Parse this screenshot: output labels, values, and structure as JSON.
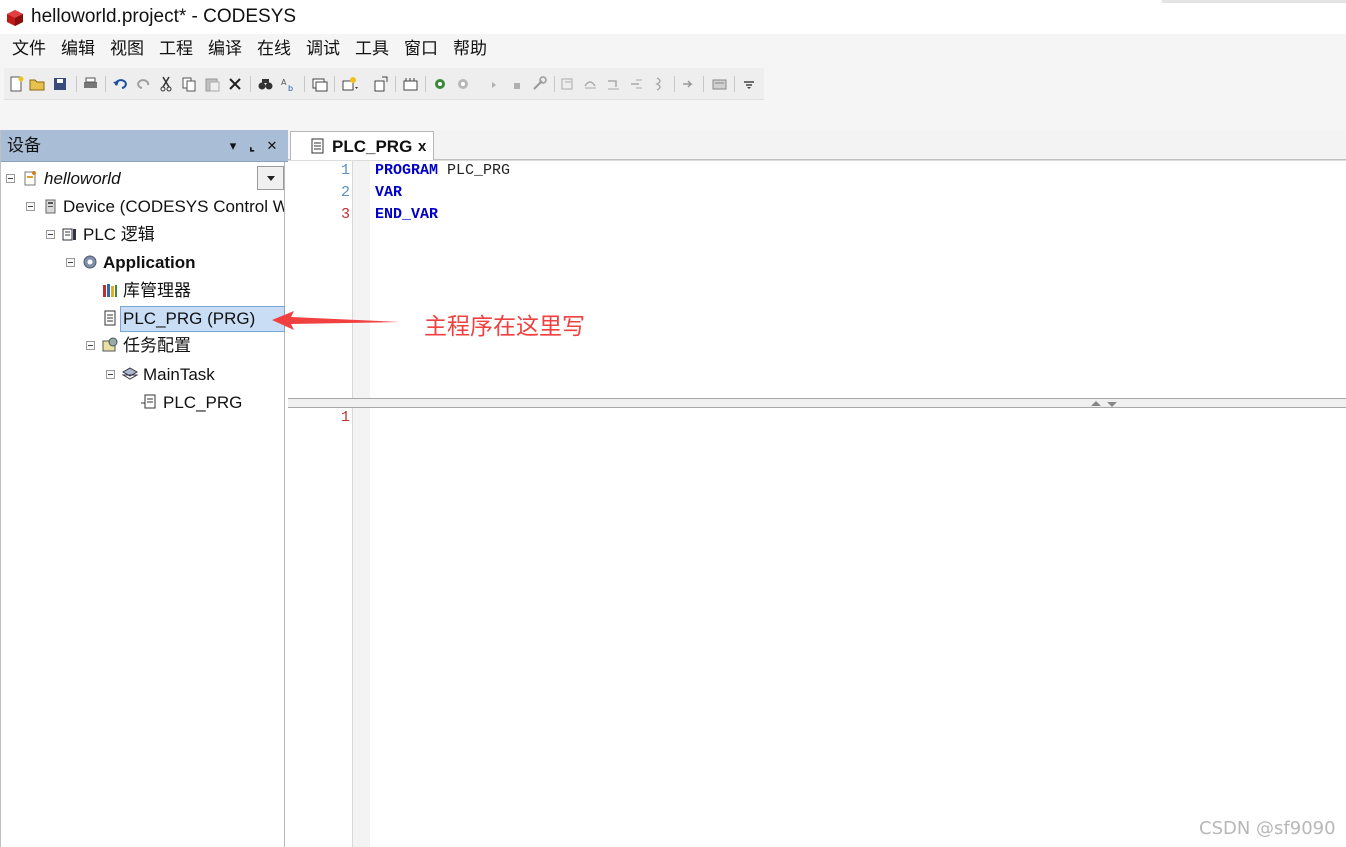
{
  "window": {
    "title": "helloworld.project* - CODESYS",
    "icon": "codesys-cube-icon"
  },
  "menu": {
    "items": [
      {
        "label": "文件"
      },
      {
        "label": "编辑"
      },
      {
        "label": "视图"
      },
      {
        "label": "工程"
      },
      {
        "label": "编译"
      },
      {
        "label": "在线"
      },
      {
        "label": "调试"
      },
      {
        "label": "工具"
      },
      {
        "label": "窗口"
      },
      {
        "label": "帮助"
      }
    ]
  },
  "toolbar": {
    "icons": [
      "new-file-icon",
      "open-folder-icon",
      "save-icon",
      "print-icon",
      "undo-icon",
      "redo-icon",
      "cut-icon",
      "copy-icon",
      "paste-icon",
      "delete-icon",
      "find-icon",
      "replace-icon",
      "window-icon",
      "add-object-icon",
      "properties-icon",
      "build-icon",
      "login-icon",
      "logout-icon",
      "start-icon",
      "stop-icon",
      "reset-icon",
      "breakpoint-icon",
      "step-over-icon",
      "step-into-icon",
      "step-out-icon",
      "cursor-icon",
      "write-values-icon",
      "force-values-icon",
      "customize-icon"
    ]
  },
  "device_panel": {
    "title": "设备",
    "tree": [
      {
        "label": "helloworld",
        "icon": "project-icon",
        "italic": true
      },
      {
        "label": "Device (CODESYS Control Win",
        "icon": "device-icon"
      },
      {
        "label": "PLC 逻辑",
        "icon": "plc-logic-icon"
      },
      {
        "label": "Application",
        "icon": "application-gear-icon",
        "bold": true
      },
      {
        "label": "库管理器",
        "icon": "library-manager-icon"
      },
      {
        "label": "PLC_PRG (PRG)",
        "icon": "program-icon",
        "selected": true
      },
      {
        "label": "任务配置",
        "icon": "task-config-icon"
      },
      {
        "label": "MainTask",
        "icon": "task-icon"
      },
      {
        "label": "PLC_PRG",
        "icon": "program-call-icon"
      }
    ]
  },
  "editor": {
    "tab": {
      "label": "PLC_PRG",
      "close": "x"
    },
    "declaration": {
      "lines": [
        {
          "no": "1",
          "keyword": "PROGRAM",
          "rest": " PLC_PRG"
        },
        {
          "no": "2",
          "keyword": "VAR",
          "rest": ""
        },
        {
          "no": "3",
          "keyword": "END_VAR",
          "rest": ""
        }
      ]
    },
    "implementation": {
      "lines": [
        {
          "no": "1"
        }
      ]
    }
  },
  "annotation": {
    "text": "主程序在这里写"
  },
  "watermark": "CSDN @sf9090",
  "colors": {
    "keyword": "#0000c8",
    "annotation": "#f04040",
    "panel_header": "#a9bdd6",
    "selected_row": "#c9def5"
  }
}
